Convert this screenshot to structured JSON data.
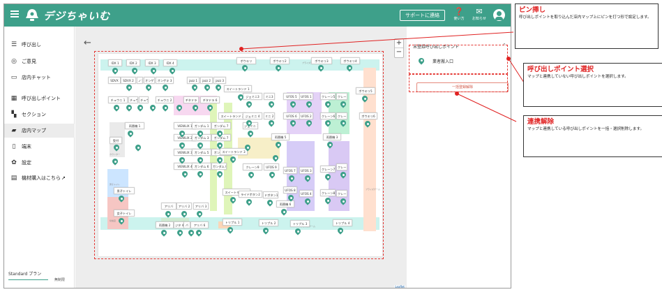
{
  "app": {
    "logo_text": "デジちゃいむ",
    "support_button": "サポートに連絡",
    "help_label": "使い方",
    "notice_label": "お知らせ"
  },
  "sidebar": {
    "items": [
      {
        "icon": "list-icon",
        "label": "呼び出し"
      },
      {
        "icon": "feedback-icon",
        "label": "ご意見"
      },
      {
        "icon": "chat-icon",
        "label": "店内チャット"
      },
      {
        "icon": "qr-code-icon",
        "label": "呼び出しポイント"
      },
      {
        "icon": "section-icon",
        "label": "セクション"
      },
      {
        "icon": "map-icon",
        "label": "店内マップ",
        "active": true
      },
      {
        "icon": "tablet-icon",
        "label": "端末"
      },
      {
        "icon": "gear-icon",
        "label": "設定"
      },
      {
        "icon": "store-icon",
        "label": "機材購入はこちら"
      }
    ],
    "plan_label": "Standard プラン",
    "plan_value": "無制限"
  },
  "map": {
    "labels": [
      "IDX 1",
      "IDX 2",
      "IDX 3",
      "IDX 4",
      "ボウキリ",
      "ボウキリ2",
      "ボウキリ3",
      "ボウキリ4",
      "SDVX",
      "SDVX 2",
      "ノブ",
      "オンゲ",
      "オンゲキ 3",
      "jazz 1",
      "jazz 2",
      "jazz 3",
      "スイートランド 1",
      "ジェミニ3",
      "ミニ3",
      "UFOS 5",
      "UFOS 1",
      "クレーン5",
      "クレーン1",
      "ボウキリ5",
      "チュウニ 1",
      "チュウニ",
      "チュウニ",
      "チュウニ 2",
      "ギタドラ",
      "ギタドラ 6",
      "スイートランド 2",
      "ジェミニ 4",
      "ミニ 2",
      "UFOS 6",
      "UFOS 2",
      "クレーン6",
      "クレーン2",
      "ボウキリ6",
      "両替機 1",
      "VIEWLIX 1",
      "ガンダム 1",
      "ガンダム 7",
      "ジェミニ 1",
      "両替機 5",
      "両替機 3",
      "VIEWLIX 2",
      "ガンダム 3",
      "ガンダム 7",
      "受付",
      "VIEWLIX 3",
      "ガンダム 5",
      "ガンダム 7",
      "スイートランド 3",
      "VIEWLIX 4",
      "ガンダム 6",
      "ガンダム 8",
      "クレーン9",
      "UFOS 9",
      "UFOS 7",
      "UFOS 3",
      "クレーン7",
      "クレーン3",
      "男子トイレ",
      "スイートランド 4",
      "ライドボタン2",
      "ドボタン1",
      "UFOS 8",
      "UFOS 4",
      "クレーン8",
      "クレーン4",
      "アリバ",
      "アリバ 2",
      "アリバ 3",
      "両替機 6",
      "女子トイレ",
      "両替機 2",
      "ジタ 4",
      "バ",
      "アリバ 6",
      "トリプル 1",
      "トリプル 2",
      "トリプル 3",
      "トリプル 4"
    ],
    "zone_texts": [
      "プライズゲーム",
      "カウンター",
      "プライズゲーム",
      "男子トイレ",
      "化粧室",
      "プライズゲーム"
    ],
    "attribution": "Leaflet"
  },
  "panel": {
    "title": "未登録呼び出しポイント",
    "item_label": "業者搬入口",
    "unlink_button": "一括登録解除"
  },
  "annotations": [
    {
      "title": "ピン挿し",
      "body": "呼び出しポイントを取り込んだ店内マップ上にピンを打つ形で設定します。"
    },
    {
      "title": "呼び出しポイント選択",
      "body": "マップと連携していない呼び出しポイントを選択します。"
    },
    {
      "title": "連携解除",
      "body": "マップと連携している呼び出しポイントを一括・選択削除します。"
    }
  ],
  "colors": {
    "brand": "#3ea08a",
    "highlight": "#e53935"
  }
}
